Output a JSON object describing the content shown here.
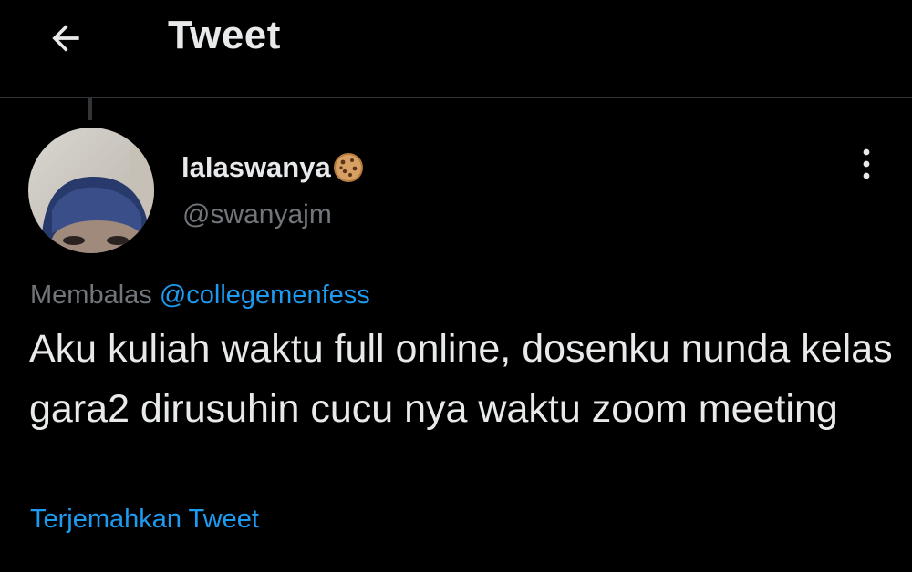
{
  "header": {
    "back_icon": "arrow-left-icon",
    "title": "Tweet"
  },
  "tweet": {
    "author": {
      "display_name": "lalaswanya",
      "badge_icon": "cookie-icon",
      "handle": "@swanyajm"
    },
    "more_icon": "more-vertical-icon",
    "reply_prefix": "Membalas",
    "reply_mention": "@collegemenfess",
    "text": "Aku kuliah waktu full online, dosenku nunda kelas gara2 dirusuhin cucu nya waktu zoom meeting",
    "translate_label": "Terjemahkan Tweet"
  },
  "colors": {
    "background": "#000000",
    "primary_text": "#e7e9ea",
    "secondary_text": "#71767b",
    "accent": "#1d9bf0",
    "divider": "#2f3336"
  }
}
